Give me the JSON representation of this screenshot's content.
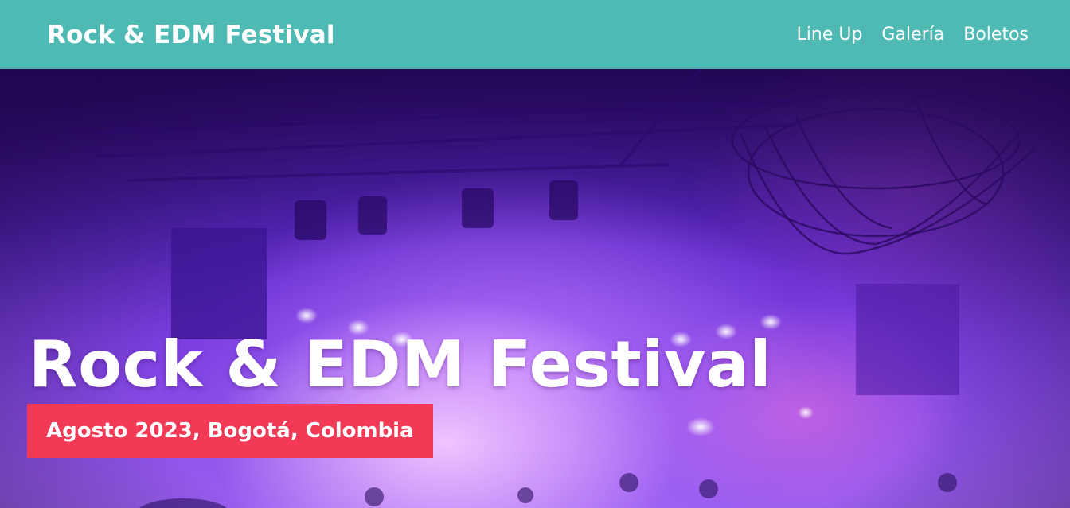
{
  "header": {
    "brand": "Rock & EDM Festival",
    "nav": [
      "Line Up",
      "Galería",
      "Boletos"
    ]
  },
  "hero": {
    "title": "Rock & EDM Festival",
    "subtitle": "Agosto 2023, Bogotá, Colombia"
  },
  "colors": {
    "header_bg": "#4fb9b3",
    "badge_bg": "#f23a57",
    "hero_purple": "#7a3ee0"
  }
}
